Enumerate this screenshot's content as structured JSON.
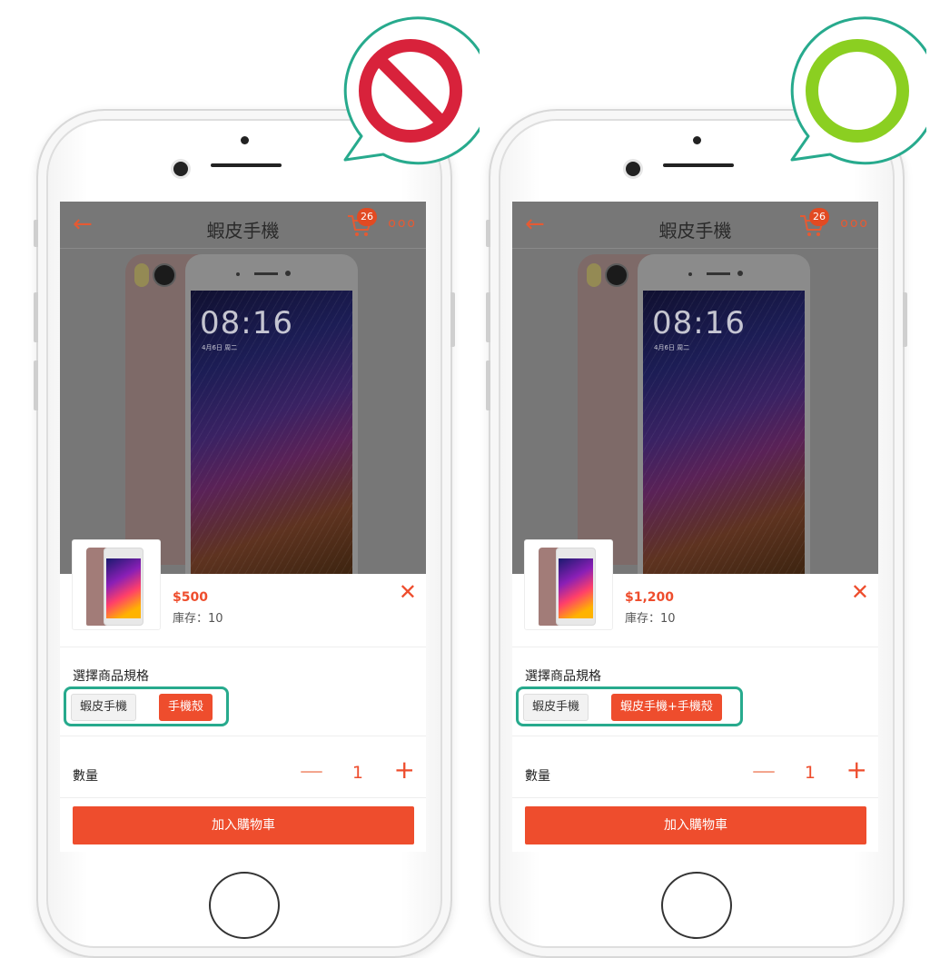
{
  "colors": {
    "accent": "#ee4d2d",
    "highlight": "#27aa8d",
    "wrong": "#d8223b",
    "right": "#8bcf21",
    "bubble_border": "#27aa8d"
  },
  "badges": {
    "wrong_icon": "prohibition-icon",
    "right_icon": "circle-ok-icon"
  },
  "common": {
    "nav_title": "蝦皮手機",
    "cart_count": "26",
    "more": "ooo",
    "back": "←",
    "close": "✕",
    "clock": "08:16",
    "clock_date": "4月6日 周二",
    "spec_label": "選擇商品規格",
    "qty_label": "數量",
    "qty_minus": "—",
    "qty_value": "1",
    "qty_plus": "+",
    "cta": "加入購物車"
  },
  "left": {
    "price": "$500",
    "stock": "庫存：10",
    "options": [
      "蝦皮手機",
      "手機殼"
    ],
    "selected_option": "手機殼"
  },
  "right": {
    "price": "$1,200",
    "stock": "庫存：10",
    "options": [
      "蝦皮手機",
      "蝦皮手機+手機殼"
    ],
    "selected_option": "蝦皮手機+手機殼"
  }
}
